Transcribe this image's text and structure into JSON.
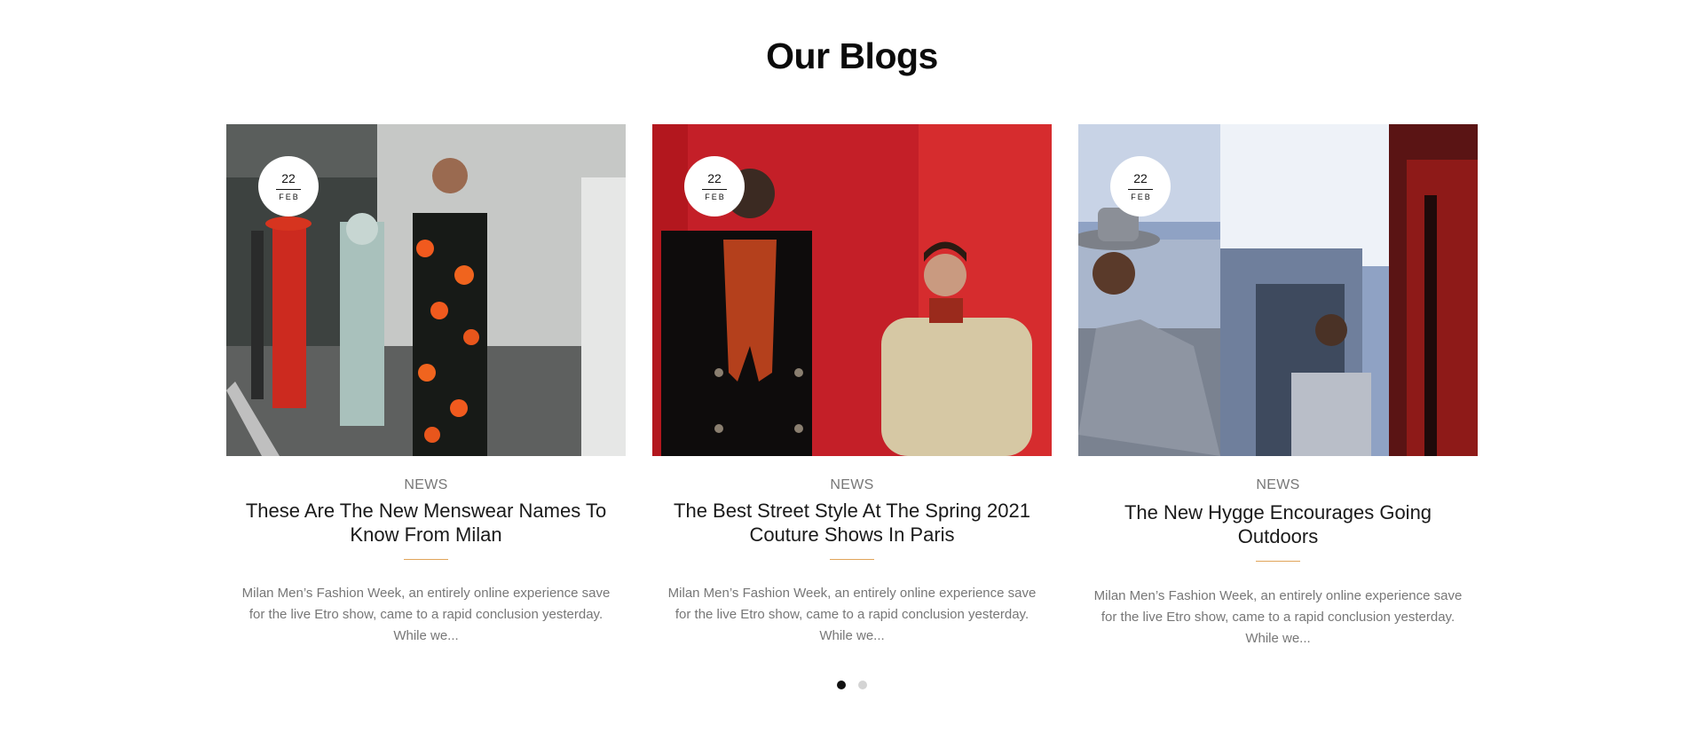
{
  "section": {
    "title": "Our Blogs"
  },
  "posts": [
    {
      "day": "22",
      "month": "FEB",
      "category": "NEWS",
      "title": "These Are The New Menswear Names To Know From Milan",
      "excerpt": "Milan Men’s Fashion Week, an entirely online experience save for the live Etro show, came to a rapid conclusion yesterday. While we..."
    },
    {
      "day": "22",
      "month": "FEB",
      "category": "NEWS",
      "title": "The Best Street Style At The Spring 2021 Couture Shows In Paris",
      "excerpt": "Milan Men’s Fashion Week, an entirely online experience save for the live Etro show, came to a rapid conclusion yesterday. While we..."
    },
    {
      "day": "22",
      "month": "FEB",
      "category": "NEWS",
      "title": "The New Hygge Encourages Going Outdoors",
      "excerpt": "Milan Men’s Fashion Week, an entirely online experience save for the live Etro show, came to a rapid conclusion yesterday. While we..."
    }
  ],
  "carousel": {
    "pages": 2,
    "active_index": 0
  },
  "colors": {
    "accent_rule": "#e0a45a",
    "dot_active": "#111111",
    "dot_inactive": "#d4d4d4"
  }
}
